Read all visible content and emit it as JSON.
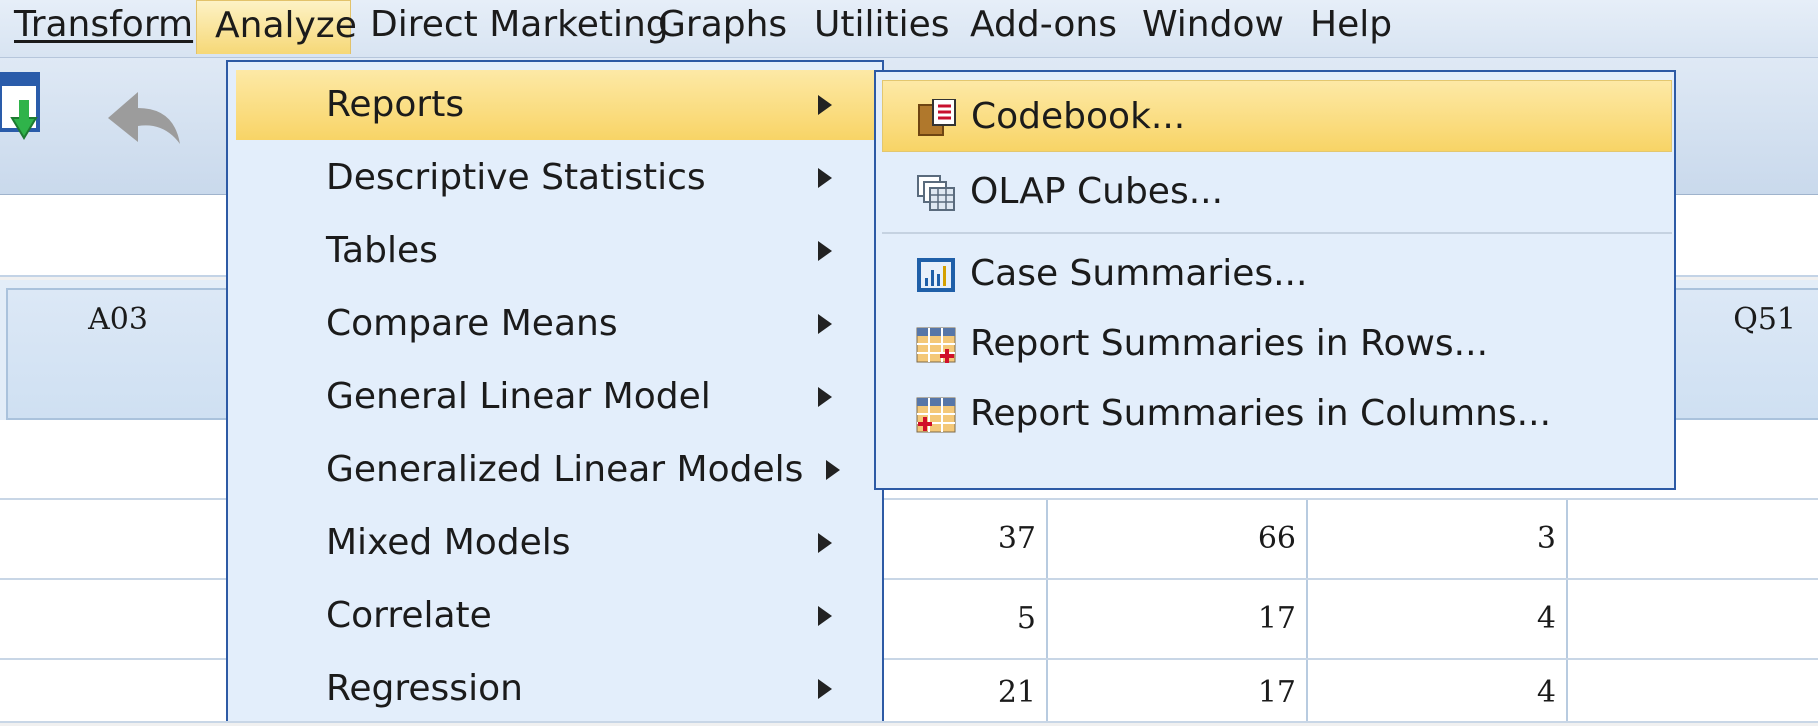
{
  "menubar": {
    "transform": "Transform",
    "analyze": "Analyze",
    "direct_marketing": "Direct Marketing",
    "graphs": "Graphs",
    "utilities": "Utilities",
    "add_ons": "Add-ons",
    "window": "Window",
    "help": "Help"
  },
  "grid": {
    "columns": [
      "A03",
      "Q51"
    ],
    "rows": [
      [
        "37",
        "66",
        "3"
      ],
      [
        "5",
        "17",
        "4"
      ],
      [
        "21",
        "17",
        "4"
      ]
    ]
  },
  "analyze_menu": {
    "items": [
      "Reports",
      "Descriptive Statistics",
      "Tables",
      "Compare Means",
      "General Linear Model",
      "Generalized Linear Models",
      "Mixed Models",
      "Correlate",
      "Regression"
    ]
  },
  "reports_submenu": {
    "items": [
      {
        "label": "Codebook...",
        "icon": "codebook-icon"
      },
      {
        "label": "OLAP Cubes...",
        "icon": "olap-cubes-icon"
      },
      {
        "label": "Case Summaries...",
        "icon": "case-summaries-icon"
      },
      {
        "label": "Report Summaries in Rows...",
        "icon": "report-rows-icon"
      },
      {
        "label": "Report Summaries in Columns...",
        "icon": "report-columns-icon"
      }
    ]
  },
  "toolbar": {
    "icon_a": "A",
    "icon_1": "1"
  },
  "colors": {
    "highlight": "#f8d466",
    "menu_bg": "#e3eefb",
    "menu_border": "#2d5aa5"
  }
}
